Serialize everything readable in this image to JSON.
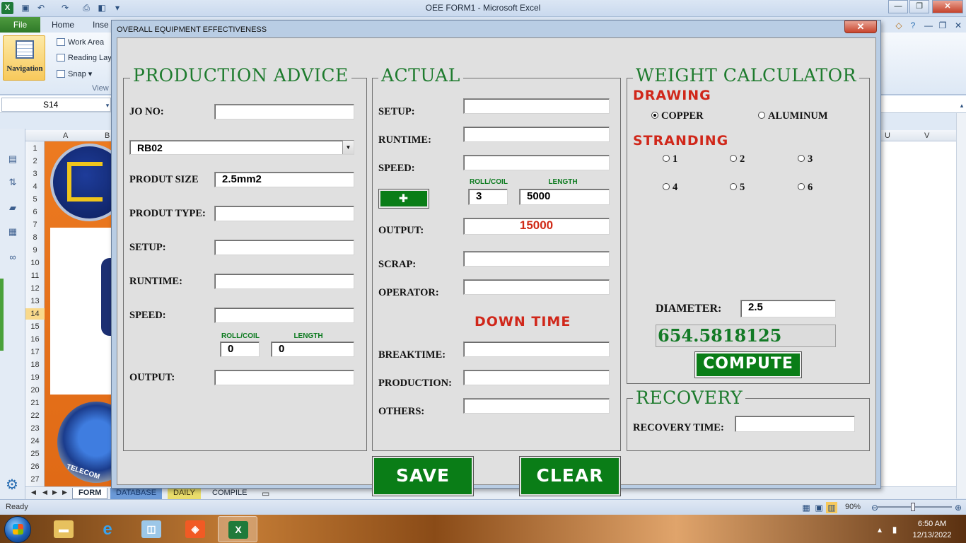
{
  "excel": {
    "window_title": "OEE FORM1  -  Microsoft Excel",
    "tabs": {
      "file": "File",
      "home": "Home",
      "insert": "Inse"
    },
    "ribbon": {
      "navigation": "Navigation",
      "work_area": "Work Area",
      "reading_layout": "Reading Lay",
      "snap": "Snap",
      "group_view": "View"
    },
    "name_box": "S14",
    "columns": {
      "a": "A",
      "b": "B",
      "u": "U",
      "v": "V"
    },
    "rows": [
      "1",
      "2",
      "3",
      "4",
      "5",
      "6",
      "7",
      "8",
      "9",
      "10",
      "11",
      "12",
      "13",
      "14",
      "15",
      "16",
      "17",
      "18",
      "19",
      "20",
      "21",
      "22",
      "23",
      "24",
      "25",
      "26",
      "27"
    ],
    "selected_row": "14",
    "sheet_tabs": [
      "FORM",
      "DATABASE",
      "DAILY",
      "COMPILE"
    ],
    "art_text": "TELECOM",
    "status": "Ready",
    "zoom": "90%"
  },
  "taskbar": {
    "time": "6:50 AM",
    "date": "12/13/2022"
  },
  "form": {
    "caption": "OVERALL EQUIPMENT EFFECTIVENESS",
    "close_glyph": "✕",
    "production_advice": {
      "title": "PRODUCTION ADVICE",
      "jo_no_label": "JO NO:",
      "jo_no": "",
      "machine": "RB02",
      "size_label": "PRODUT SIZE",
      "size": "2.5mm2",
      "type_label": "PRODUT TYPE:",
      "type": "",
      "setup_label": "SETUP:",
      "setup": "",
      "runtime_label": "RUNTIME:",
      "runtime": "",
      "speed_label": "SPEED:",
      "speed": "",
      "roll_label": "ROLL/COIL",
      "roll": "0",
      "length_label": "LENGTH",
      "length": "0",
      "output_label": "OUTPUT:",
      "output": ""
    },
    "actual": {
      "title": "ACTUAL",
      "setup_label": "SETUP:",
      "setup": "",
      "runtime_label": "RUNTIME:",
      "runtime": "",
      "speed_label": "SPEED:",
      "speed": "",
      "add_glyph": "✚",
      "roll_label": "ROLL/COIL",
      "roll": "3",
      "length_label": "LENGTH",
      "length": "5000",
      "output_label": "OUTPUT:",
      "output": "15000",
      "scrap_label": "SCRAP:",
      "scrap": "",
      "operator_label": "OPERATOR:",
      "operator": "",
      "downtime_title": "DOWN TIME",
      "breaktime_label": "BREAKTIME:",
      "breaktime": "",
      "production_label": "PRODUCTION:",
      "production": "",
      "others_label": "OTHERS:",
      "others": ""
    },
    "weight": {
      "title": "WEIGHT CALCULATOR",
      "drawing_title": "DRAWING",
      "copper": "COPPER",
      "aluminum": "ALUMINUM",
      "stranding_title": "STRANDING",
      "strands": [
        "1",
        "2",
        "3",
        "4",
        "5",
        "6"
      ],
      "diameter_label": "DIAMETER:",
      "diameter": "2.5",
      "result": "654.5818125",
      "compute": "COMPUTE"
    },
    "recovery": {
      "title": "RECOVERY",
      "time_label": "RECOVERY TIME:",
      "time": ""
    },
    "save": "SAVE",
    "clear": "CLEAR"
  },
  "colors": {
    "accent_green": "#0a7d17",
    "title_green": "#1e7b2e",
    "alert_red": "#d0271a"
  }
}
